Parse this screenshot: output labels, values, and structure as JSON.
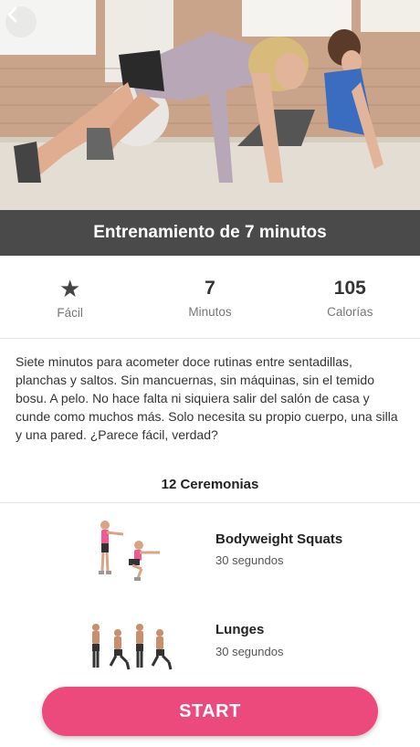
{
  "header": {
    "title": "Entrenamiento de 7 minutos"
  },
  "stats": [
    {
      "value": "",
      "icon": "star-icon",
      "label": "Fácil"
    },
    {
      "value": "7",
      "label": "Minutos"
    },
    {
      "value": "105",
      "label": "Calorías"
    }
  ],
  "description": "Siete minutos para acometer doce rutinas entre sentadillas, planchas y saltos. Sin mancuernas, sin máquinas, sin el temido bosu. A pelo. No hace falta ni siquiera salir del salón de casa y cunde como muchos más. Solo necesita su propio cuerpo, una silla y una pared. ¿Parece fácil, verdad?",
  "exercises_section": {
    "title": "12 Ceremonias",
    "items": [
      {
        "name": "Bodyweight Squats",
        "duration": "30 segundos",
        "image": "squat-illustration"
      },
      {
        "name": "Lunges",
        "duration": "30 segundos",
        "image": "lunge-illustration"
      }
    ]
  },
  "start_button": {
    "label": "START"
  },
  "colors": {
    "accent": "#ec4a7c",
    "title_bar": "#4a4a4a"
  }
}
